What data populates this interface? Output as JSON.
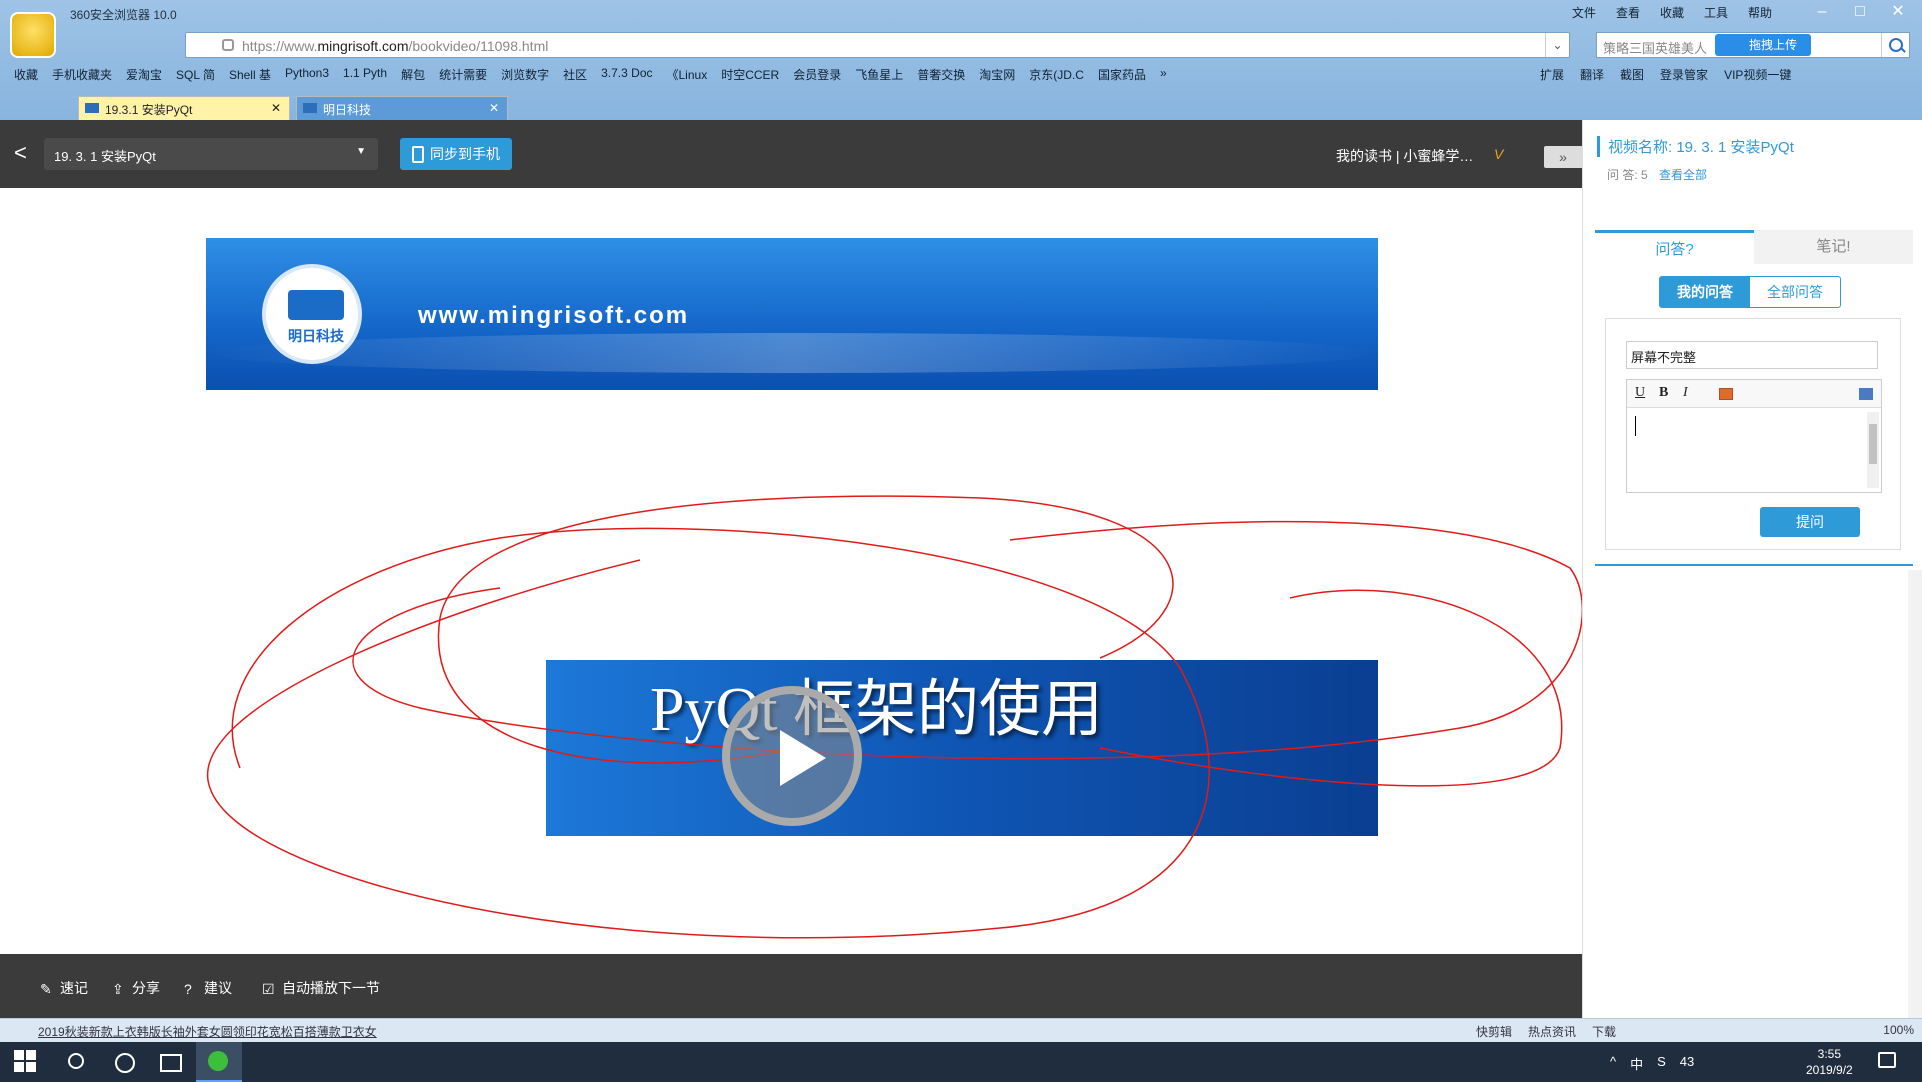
{
  "browser": {
    "app_title": "360安全浏览器 10.0",
    "menu": [
      "文件",
      "查看",
      "收藏",
      "工具",
      "帮助"
    ],
    "url_prefix": "https://www.",
    "url_domain": "mingrisoft.com",
    "url_path": "/bookvideo/11098.html",
    "search_placeholder": "策略三国英雄美人",
    "upload_label": "拖拽上传",
    "bookmarks": [
      "收藏",
      "手机收藏夹",
      "爱淘宝",
      "SQL 简",
      "Shell 基",
      "Python3",
      "1.1 Pyth",
      "解包",
      "统计需要",
      "浏览数字",
      "社区",
      "3.7.3 Doc",
      "《Linux",
      "时空CCER",
      "会员登录",
      "飞鱼星上",
      "普奢交换",
      "淘宝网",
      "京东(JD.C",
      "国家药品",
      "»"
    ],
    "bookmarks_right": [
      "扩展",
      "翻译",
      "截图",
      "登录管家",
      "VIP视频一键"
    ],
    "tabs": [
      {
        "label": "19.3.1 安装PyQt",
        "active": true
      },
      {
        "label": "明日科技",
        "active": false
      }
    ]
  },
  "player": {
    "back": "<",
    "lesson": "19. 3. 1  安装PyQt",
    "sync_label": "同步到手机",
    "my_books": "我的读书",
    "user": "小蜜蜂学…",
    "vip": "V",
    "collapse": "»",
    "slide": {
      "brand_cn": "明日科技",
      "brand_url": "www.mingrisoft.com",
      "title": "PyQt  框架的使用"
    },
    "bottom": {
      "note": "速记",
      "share": "分享",
      "suggest": "建议",
      "autoplay": "自动播放下一节"
    }
  },
  "sidebar": {
    "video_name": "视频名称: 19. 3. 1 安装PyQt",
    "qa_label": "问    答: 5",
    "view_all": "查看全部",
    "tab_qa": "问答?",
    "tab_notes": "笔记!",
    "seg_mine": "我的问答",
    "seg_all": "全部问答",
    "question_value": "屏幕不完整",
    "editor_tools": {
      "underline": "U",
      "bold": "B",
      "italic": "I"
    },
    "ask_label": "提问"
  },
  "statusbar": {
    "news": "2019秋装新款上衣韩版长袖外套女圆领印花宽松百搭薄款卫衣女",
    "items": [
      "快剪辑",
      "热点资讯",
      "下载"
    ],
    "zoom": "100%"
  },
  "taskbar": {
    "tray": [
      "^",
      "中",
      "S",
      "43"
    ],
    "time": "3:55",
    "date": "2019/9/2"
  },
  "colors": {
    "accent": "#2f9ad8",
    "player_bg": "#3b3b3b",
    "chrome_bg": "#9ec3e6",
    "scribble": "#e01a1a"
  }
}
